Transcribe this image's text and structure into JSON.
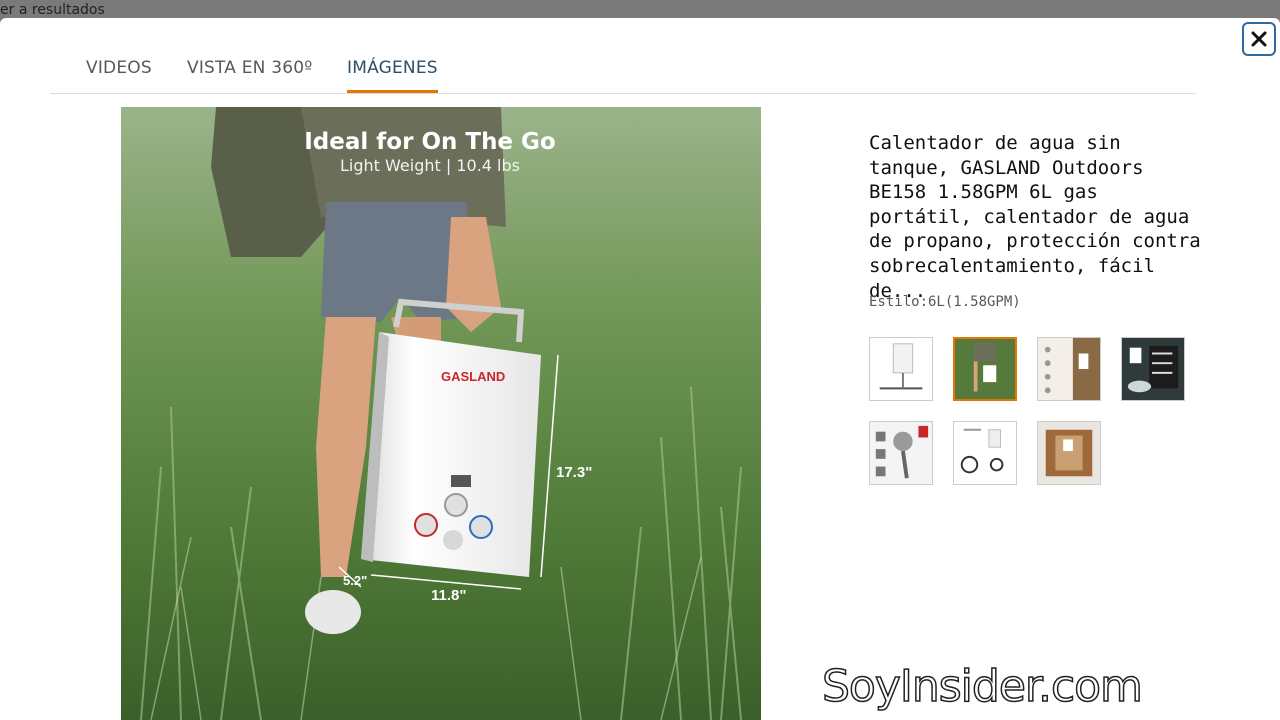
{
  "background": {
    "back_link": "er a resultados"
  },
  "modal": {
    "close_label": "×",
    "tabs": [
      {
        "label": "VIDEOS",
        "active": false
      },
      {
        "label": "VISTA EN 360º",
        "active": false
      },
      {
        "label": "IMÁGENES",
        "active": true
      }
    ],
    "accent_color": "#e77600"
  },
  "main_image": {
    "headline": "Ideal for On The Go",
    "subline": "Light Weight | 10.4 lbs",
    "brand": "GASLAND",
    "dim_height": "17.3\"",
    "dim_width": "11.8\"",
    "dim_depth": "5.2\""
  },
  "product": {
    "title": "Calentador de agua sin tanque, GASLAND Outdoors BE158 1.58GPM 6L gas portátil, calentador de agua de propano, protección contra sobrecalentamiento, fácil de...",
    "style": "Estilo:6L(1.58GPM)"
  },
  "thumbnails": [
    {
      "name": "thumb-heater-white",
      "selected": false
    },
    {
      "name": "thumb-outdoor-carry",
      "selected": true
    },
    {
      "name": "thumb-features",
      "selected": false
    },
    {
      "name": "thumb-dark-specs",
      "selected": false
    },
    {
      "name": "thumb-shower-head",
      "selected": false
    },
    {
      "name": "thumb-accessories",
      "selected": false
    },
    {
      "name": "thumb-shower-enclosure",
      "selected": false
    }
  ],
  "watermark": "SoyInsider.com"
}
